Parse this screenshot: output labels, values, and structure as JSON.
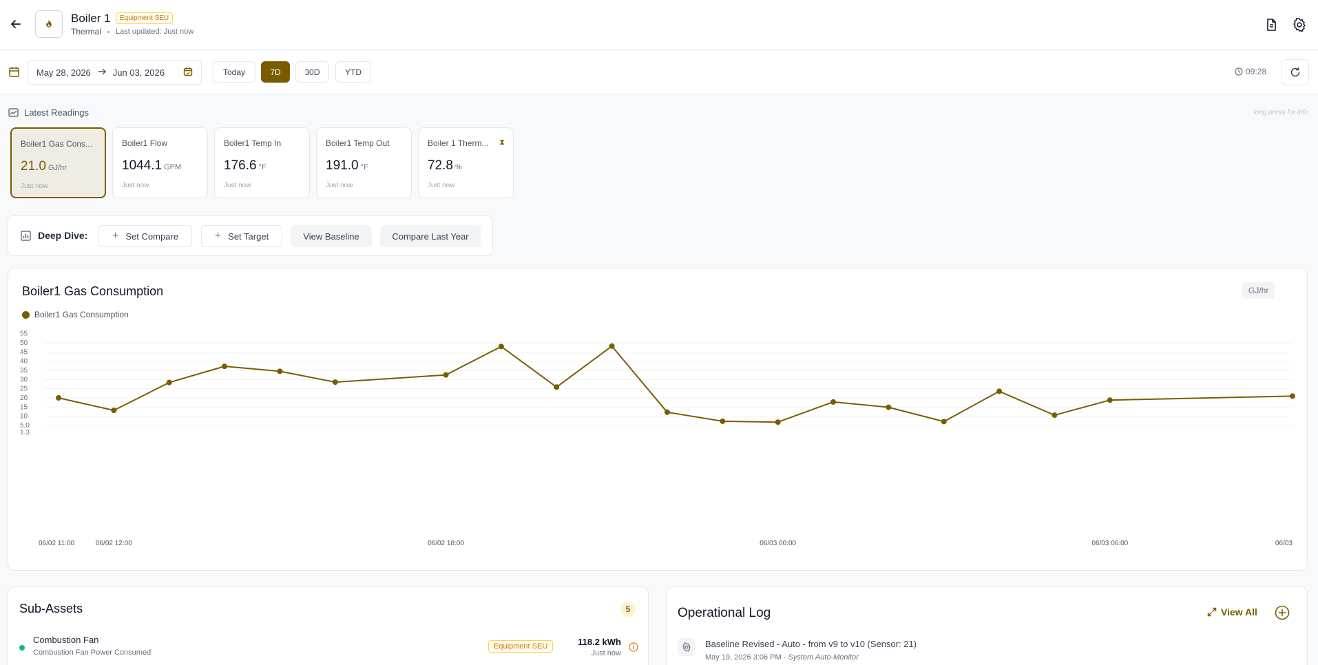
{
  "header": {
    "title": "Boiler 1",
    "badge": "Equipment SEU",
    "category": "Thermal",
    "last_updated": "Last updated: Just now"
  },
  "toolbar": {
    "start_date": "May 28, 2026",
    "end_date": "Jun 03, 2026",
    "ranges": [
      "Today",
      "7D",
      "30D",
      "YTD"
    ],
    "active_range": "7D",
    "time": "09:28"
  },
  "readings": {
    "label": "Latest Readings",
    "hint": "long press for info",
    "cards": [
      {
        "title": "Boiler1 Gas Cons...",
        "value": "21.0",
        "unit": "GJ/hr",
        "time": "Just now"
      },
      {
        "title": "Boiler1 Flow",
        "value": "1044.1",
        "unit": "GPM",
        "time": "Just now"
      },
      {
        "title": "Boiler1 Temp In",
        "value": "176.6",
        "unit": "°F",
        "time": "Just now"
      },
      {
        "title": "Boiler1 Temp Out",
        "value": "191.0",
        "unit": "°F",
        "time": "Just now"
      },
      {
        "title": "Boiler 1 Therm...",
        "value": "72.8",
        "unit": "%",
        "time": "Just now"
      }
    ]
  },
  "deep_dive": {
    "label": "Deep Dive:",
    "set_compare": "Set Compare",
    "set_target": "Set Target",
    "view_baseline": "View Baseline",
    "compare_last_year": "Compare Last Year"
  },
  "chart": {
    "title": "Boiler1 Gas Consumption",
    "unit": "GJ/hr",
    "legend": "Boiler1 Gas Consumption"
  },
  "chart_data": {
    "type": "line",
    "title": "Boiler1 Gas Consumption",
    "xlabel": "",
    "ylabel": "",
    "ylim": [
      1.3,
      55
    ],
    "y_ticks": [
      "1.3",
      "5.0",
      "10",
      "15",
      "20",
      "25",
      "30",
      "35",
      "40",
      "45",
      "50",
      "55"
    ],
    "y_tick_values": [
      1.3,
      5,
      10,
      15,
      20,
      25,
      30,
      35,
      40,
      45,
      50,
      55
    ],
    "x_ticks": [
      "06/02 11:00",
      "06/02 12:00",
      "06/02 18:00",
      "06/03 00:00",
      "06/03 06:00",
      "06/03"
    ],
    "x_tick_hours": [
      0,
      1,
      7,
      13,
      19,
      22.3
    ],
    "xlim_hours": [
      0,
      22.3
    ],
    "series": [
      {
        "name": "Boiler1 Gas Consumption",
        "color": "#7a5c00",
        "x_hours": [
          0,
          1,
          2,
          3,
          4,
          5,
          7,
          8,
          9,
          10,
          11,
          12,
          13,
          14,
          15,
          16,
          17,
          18,
          19,
          22.3
        ],
        "values": [
          20,
          13.2,
          28.4,
          37.2,
          34.5,
          28.6,
          32.5,
          48.0,
          25.9,
          48.2,
          12.2,
          7.3,
          6.8,
          17.8,
          14.9,
          7.1,
          23.6,
          10.6,
          18.8,
          21.0
        ]
      }
    ]
  },
  "sub_assets": {
    "title": "Sub-Assets",
    "count": "5",
    "items": [
      {
        "name": "Combustion Fan",
        "description": "Combustion Fan Power Consumed",
        "badge": "Equipment SEU",
        "value": "118.2 kWh",
        "time": "Just now",
        "status_color": "#10b981"
      }
    ]
  },
  "operational_log": {
    "title": "Operational Log",
    "view_all": "View All",
    "entries": [
      {
        "text": "Baseline Revised - Auto - from v9 to v10 (Sensor: 21)",
        "date": "May 19, 2026 3:06 PM",
        "separator": "·",
        "by": "System Auto-Monitor"
      }
    ]
  },
  "colors": {
    "accent": "#7a5c00",
    "badge_text": "#d97706",
    "status_green": "#10b981"
  }
}
